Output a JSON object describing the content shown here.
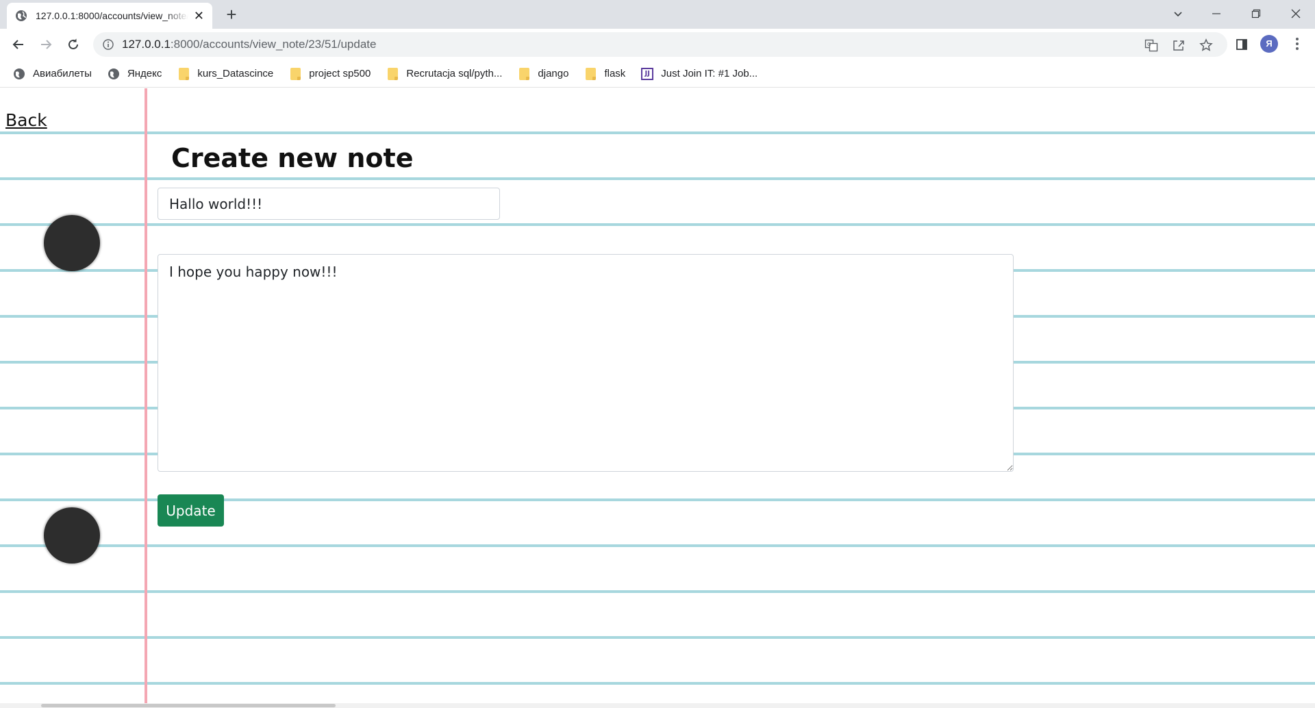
{
  "browser": {
    "tab": {
      "title": "127.0.0.1:8000/accounts/view_note/23/51/update",
      "close": "✕"
    },
    "new_tab": "+",
    "address": {
      "host": "127.0.0.1",
      "rest": ":8000/accounts/view_note/23/51/update"
    },
    "profile_initial": "Я",
    "bookmarks": [
      {
        "label": "Авиабилеты",
        "icon": "globe-icon"
      },
      {
        "label": "Яндекс",
        "icon": "globe-icon"
      },
      {
        "label": "kurs_Datascince",
        "icon": "folder-icon"
      },
      {
        "label": "project sp500",
        "icon": "folder-icon"
      },
      {
        "label": "Recrutacja sql/pyth...",
        "icon": "folder-icon"
      },
      {
        "label": "django",
        "icon": "folder-icon"
      },
      {
        "label": "flask",
        "icon": "folder-icon"
      },
      {
        "label": "Just Join IT: #1 Job...",
        "icon": "justjoin-icon",
        "icon_text": "JJ"
      }
    ]
  },
  "page": {
    "back_link": "Back",
    "title": "Create new note",
    "form": {
      "title_value": "Hallo world!!!",
      "content_value": "I hope you happy now!!!",
      "submit_label": "Update"
    }
  },
  "colors": {
    "paper_line": "#a7d7de",
    "margin_line": "#f4a7b3",
    "hole": "#2d2d2d",
    "button": "#198754"
  }
}
